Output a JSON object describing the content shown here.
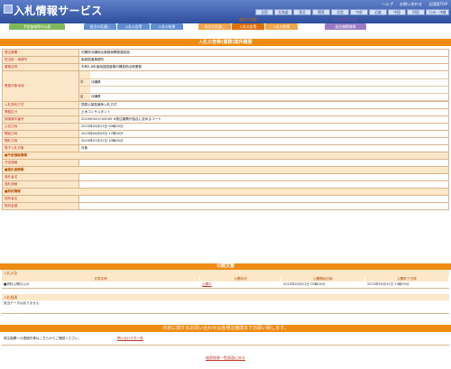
{
  "header": {
    "title": "入札情報サービス",
    "links": [
      "ヘルプ",
      "お問い合わせ",
      "全国版TOP"
    ],
    "regions": [
      "全国",
      "北海道",
      "東北",
      "関東",
      "北陸",
      "中部",
      "近畿",
      "中国",
      "四国",
      "九州・沖縄"
    ]
  },
  "nav": {
    "group1": {
      "title": "予定価格の検索",
      "buttons": [
        "予定価格等の公表"
      ]
    },
    "group2": {
      "title": "工事の検索",
      "buttons": [
        "発注の見通し",
        "入札公告等",
        "入札の結果"
      ]
    },
    "group3": {
      "title": "業務の検索",
      "buttons": [
        "発注の見通し",
        "入札公告等",
        "入札の結果"
      ]
    },
    "group4": {
      "title": "発注機関の検索",
      "buttons": [
        "発注機関情報"
      ]
    }
  },
  "sheet": {
    "title": "入札公告等(業務)案件概要",
    "rows": [
      {
        "label": "発注機関",
        "value": "内閣府沖縄総合事務局開発建設部"
      },
      {
        "label": "担当部・事務所",
        "value": "南部国道事務所"
      },
      {
        "label": "業務名称",
        "value": "令和5-6年度南部国道管内構造物点検業務"
      },
      {
        "label": "業務対象地域",
        "sub": [
          {
            "k": "市",
            "v": "沖縄県"
          },
          {
            "k": "区",
            "v": "沖縄県"
          }
        ]
      },
      {
        "label": "入札契約方式",
        "value": "簡易公募型競争入札方式"
      },
      {
        "label": "業務区分",
        "value": "土木コンサルタント"
      },
      {
        "label": "調達案件番号",
        "value": "202390023743000     ※発注機関が独自に定めるコード"
      },
      {
        "label": "公告日時",
        "value": "2023年03月23日 00時00分"
      },
      {
        "label": "開始日時",
        "value": "2023年04月03日 17時00分"
      },
      {
        "label": "開札日時",
        "value": "2023年07月31日 10時00分"
      },
      {
        "label": "電子入札対象",
        "value": "対象"
      }
    ],
    "sections": [
      {
        "title": "■予定価格情報",
        "rows": [
          {
            "label": "予定価格",
            "value": ""
          }
        ]
      },
      {
        "title": "■落札者情報",
        "rows": [
          {
            "label": "落札者名",
            "value": ""
          },
          {
            "label": "落札価格",
            "value": ""
          }
        ]
      },
      {
        "title": "■契約情報",
        "rows": [
          {
            "label": "契約者名",
            "value": ""
          },
          {
            "label": "契約金額",
            "value": ""
          }
        ]
      }
    ]
  },
  "public_docs": {
    "title": "公開文書",
    "section": "入札公告",
    "columns": [
      "文書名称",
      "公開状況",
      "公開開始日時",
      "公開終了日時"
    ],
    "rows": [
      {
        "name": "■資料公開の公示",
        "status": "公開中",
        "start": "2023年03月23日 00時00分",
        "end": "2023年05月31日 23時59分"
      }
    ]
  },
  "history": {
    "section": "入札経過",
    "empty_text": "該当データはありません"
  },
  "contact": {
    "bar_text": "内容に関するお問い合わせは各発注機関までお願い致します。",
    "text": "発注機関への連絡先等はこちらからご確認ください。",
    "link": "問い合わせ先一覧"
  },
  "footer": {
    "back_link": "検索結果一覧画面に戻る"
  },
  "colors": {
    "header": "#2f4f9e",
    "accent": "#ef8a12",
    "label_bg": "#fde7c9"
  }
}
